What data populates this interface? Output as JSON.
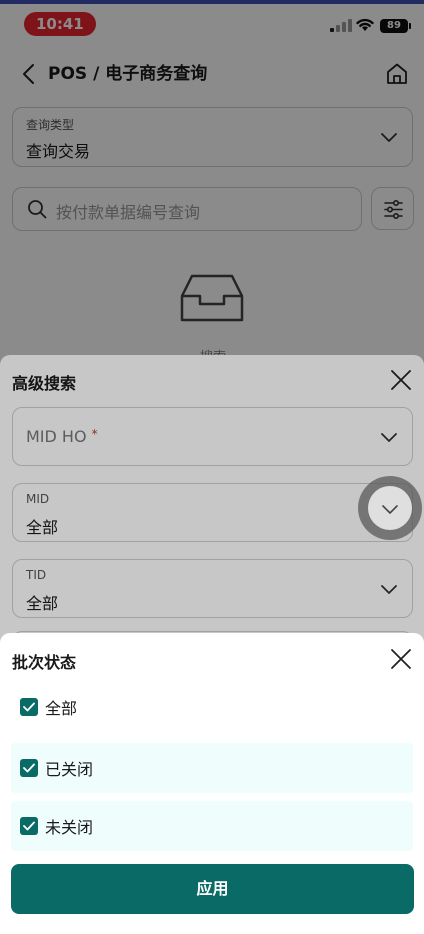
{
  "status_bar": {
    "time": "10:41",
    "battery": "89"
  },
  "nav": {
    "title": "POS / 电子商务查询"
  },
  "query_type": {
    "label": "查询类型",
    "value": "查询交易"
  },
  "search": {
    "placeholder": "按付款单据编号查询"
  },
  "empty_state": {
    "text": "搜索"
  },
  "advanced_search": {
    "title": "高级搜索",
    "mid_ho": {
      "label": "MID HO",
      "required_mark": "*"
    },
    "mid": {
      "label": "MID",
      "value": "全部"
    },
    "tid": {
      "label": "TID",
      "value": "全部"
    }
  },
  "batch_status": {
    "title": "批次状态",
    "options": [
      {
        "label": "全部",
        "checked": true
      },
      {
        "label": "已关闭",
        "checked": true
      },
      {
        "label": "未关闭",
        "checked": true
      }
    ],
    "apply_label": "应用"
  },
  "colors": {
    "accent": "#0a6b66",
    "time_pill": "#e8262f",
    "highlight_row": "#f0fdfd"
  }
}
